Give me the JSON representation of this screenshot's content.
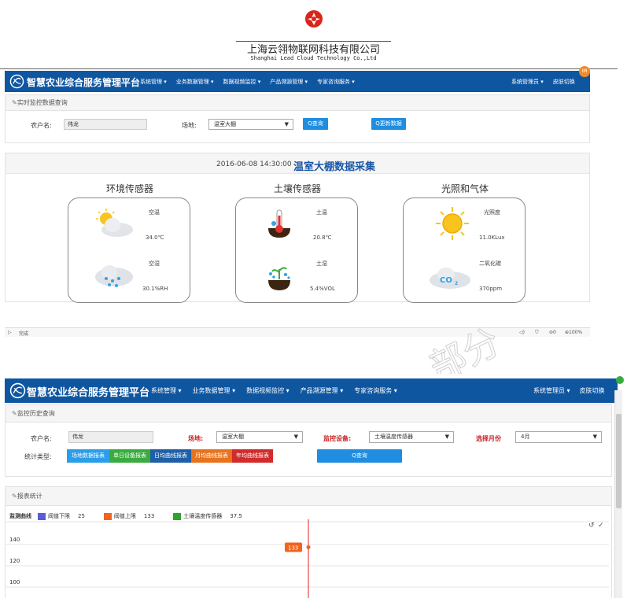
{
  "company": {
    "name_cn": "上海云翎物联网科技有限公司",
    "name_en": "Shanghai Lead Cloud Technology Co.,Ltd"
  },
  "nav": {
    "brand": "智慧农业综合服务管理平台",
    "items": [
      "系统管理 ▾",
      "业务数据管理 ▾",
      "数据视频监控 ▾",
      "产品溯源管理 ▾",
      "专家咨询服务 ▾"
    ],
    "admin": "系统管理员 ▾",
    "skin": "皮肤切换",
    "badge": "IM"
  },
  "realtime": {
    "panel_title": "实时监控数据查询",
    "farmer_label": "农户名:",
    "farmer_value": "伟龙",
    "field_label": "场地:",
    "field_value": "温室大棚",
    "query_btn": "Q查询",
    "more_btn": "Q更新数据",
    "datetime": "2016-06-08 14:30:00",
    "title": "温室大棚数据采集",
    "groups": [
      {
        "title": "环境传感器",
        "sensors": [
          {
            "name": "空温",
            "value": "34.0℃",
            "icon": "sun-cloud-icon"
          },
          {
            "name": "空湿",
            "value": "30.1%RH",
            "icon": "rain-cloud-icon"
          }
        ]
      },
      {
        "title": "土壤传感器",
        "sensors": [
          {
            "name": "土温",
            "value": "20.8℃",
            "icon": "soil-thermometer-icon"
          },
          {
            "name": "土湿",
            "value": "5.4%VOL",
            "icon": "soil-sprout-icon"
          }
        ]
      },
      {
        "title": "光照和气体",
        "sensors": [
          {
            "name": "光照度",
            "value": "11.0KLux",
            "icon": "sun-icon"
          },
          {
            "name": "二氧化碳",
            "value": "370ppm",
            "icon": "co2-cloud-icon"
          }
        ]
      }
    ]
  },
  "statusbar": {
    "left": "完成",
    "right_items": [
      "◁)",
      "⛉",
      "⊜0",
      "⊕100%"
    ]
  },
  "history": {
    "panel_title": "监控历史查询",
    "farmer_label": "农户名:",
    "farmer_value": "伟龙",
    "field_label": "场地:",
    "field_value": "温室大棚",
    "device_label": "监控设备:",
    "device_value": "土壤温度传感器",
    "month_label": "选择月份",
    "month_value": "4月",
    "type_label": "统计类型:",
    "type_buttons": [
      {
        "label": "场地数据报表",
        "color": "#2a9ee8"
      },
      {
        "label": "单日设备报表",
        "color": "#3aab3e"
      },
      {
        "label": "日均曲线报表",
        "color": "#1f5fa8"
      },
      {
        "label": "月均曲线报表",
        "color": "#e8731c"
      },
      {
        "label": "年均曲线报表",
        "color": "#d22b2b"
      }
    ],
    "query_btn": "Q查询"
  },
  "report": {
    "panel_title": "报表统计",
    "legend_title": "监测曲线",
    "legend": [
      {
        "name": "阈值下限",
        "value": "25",
        "color": "#5b5bd6"
      },
      {
        "name": "阈值上限",
        "value": "133",
        "color": "#f0641e"
      },
      {
        "name": "土壤温度传感器",
        "value": "37.5",
        "color": "#2aa52a"
      }
    ],
    "tooltip_value": "133",
    "toolbar_icons": [
      "↺",
      "✓"
    ]
  },
  "chart_data": {
    "type": "line",
    "y_ticks": [
      140,
      120,
      100
    ],
    "ylim": [
      90,
      150
    ],
    "series": [
      {
        "name": "阈值上限",
        "values": [
          133
        ]
      }
    ],
    "grid": true
  },
  "watermark": "部分"
}
